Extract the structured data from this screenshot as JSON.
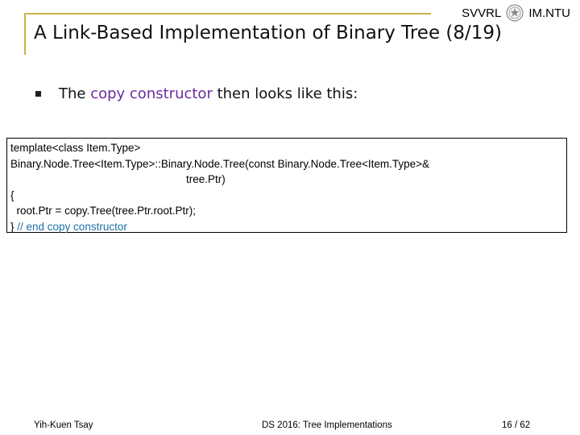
{
  "header": {
    "left_org": "SVVRL",
    "right_org": "IM.NTU"
  },
  "title": "A Link-Based Implementation of Binary Tree (8/19)",
  "bullet": {
    "prefix": "The ",
    "highlight": "copy constructor",
    "suffix": " then looks like this:"
  },
  "code": {
    "line1_kw": "template",
    "line1_lt": "<",
    "line1_kw2": "class",
    "line1_rest": " Item.Type>",
    "line2_a": "Binary.Node.Tree<Item.Type>::Binary.Node.Tree(",
    "line2_kw": "const",
    "line2_b": " Binary.Node.Tree<Item.Type>&",
    "line3": "tree.Ptr)",
    "line4": "{",
    "line5": "  root.Ptr = copy.Tree(tree.Ptr.root.Ptr);",
    "line6_a": "} ",
    "line6_comment": "// end copy constructor"
  },
  "footer": {
    "author": "Yih-Kuen Tsay",
    "course": "DS 2016: Tree Implementations",
    "page": "16 / 62"
  },
  "colors": {
    "frame": "#c9b44a",
    "highlight": "#6a2ba0",
    "comment": "#1d6fa5"
  }
}
